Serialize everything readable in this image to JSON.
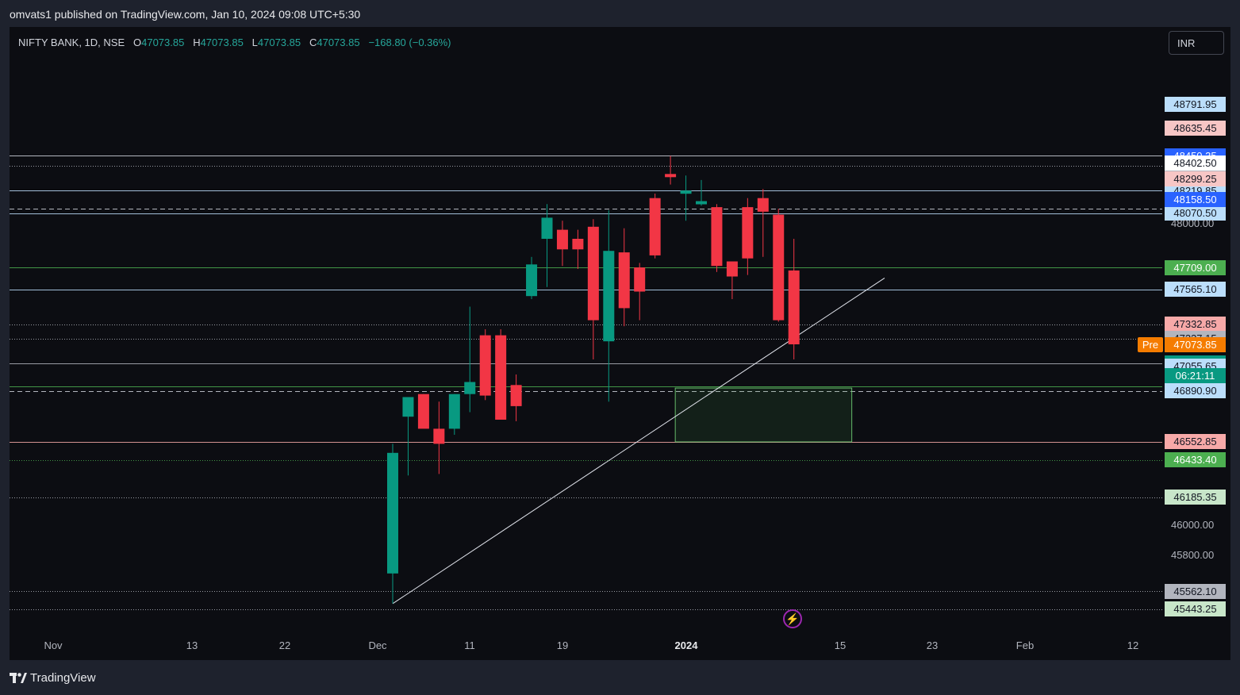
{
  "publisher": "omvats1 published on TradingView.com, Jan 10, 2024 09:08 UTC+5:30",
  "legend": {
    "symbol": "NIFTY BANK, 1D, NSE",
    "o_label": "O",
    "o": "47073.85",
    "h_label": "H",
    "h": "47073.85",
    "l_label": "L",
    "l": "47073.85",
    "c_label": "C",
    "c": "47073.85",
    "change": "−168.80 (−0.36%)"
  },
  "currency": "INR",
  "brand": "TradingView",
  "pre_label": "Pre",
  "countdown": "06:21:11",
  "colors": {
    "up": "#089981",
    "down": "#f23645",
    "background": "#0c0d12"
  },
  "chart_data": {
    "type": "candlestick",
    "x_axis_labels": [
      {
        "label": "Nov",
        "day": 0
      },
      {
        "label": "13",
        "day": 12
      },
      {
        "label": "22",
        "day": 21
      },
      {
        "label": "Dec",
        "day": 30
      },
      {
        "label": "11",
        "day": 40
      },
      {
        "label": "19",
        "day": 48
      },
      {
        "label": "2024",
        "day": 61,
        "bold": true
      },
      {
        "label": "15",
        "day": 75
      },
      {
        "label": "23",
        "day": 83
      },
      {
        "label": "Feb",
        "day": 92
      },
      {
        "label": "12",
        "day": 103
      }
    ],
    "y_axis_ticks": [
      48000,
      46000,
      45800
    ],
    "y_range": [
      45350,
      48800
    ],
    "candles": [
      {
        "date": "2023-12-04",
        "o": 45680,
        "h": 46540,
        "l": 45480,
        "c": 46480
      },
      {
        "date": "2023-12-05",
        "o": 46720,
        "h": 46840,
        "l": 46330,
        "c": 46850
      },
      {
        "date": "2023-12-06",
        "o": 46870,
        "h": 46870,
        "l": 46680,
        "c": 46640
      },
      {
        "date": "2023-12-07",
        "o": 46640,
        "h": 46820,
        "l": 46340,
        "c": 46540
      },
      {
        "date": "2023-12-08",
        "o": 46640,
        "h": 46870,
        "l": 46600,
        "c": 46870
      },
      {
        "date": "2023-12-11",
        "o": 46870,
        "h": 47450,
        "l": 46750,
        "c": 46950
      },
      {
        "date": "2023-12-12",
        "o": 47260,
        "h": 47300,
        "l": 46830,
        "c": 46860
      },
      {
        "date": "2023-12-13",
        "o": 47260,
        "h": 47300,
        "l": 46720,
        "c": 46700
      },
      {
        "date": "2023-12-14",
        "o": 46930,
        "h": 47000,
        "l": 46690,
        "c": 46790
      },
      {
        "date": "2023-12-15",
        "o": 47520,
        "h": 47780,
        "l": 47500,
        "c": 47730
      },
      {
        "date": "2023-12-18",
        "o": 47900,
        "h": 48130,
        "l": 47580,
        "c": 48040
      },
      {
        "date": "2023-12-19",
        "o": 47960,
        "h": 48020,
        "l": 47720,
        "c": 47830
      },
      {
        "date": "2023-12-20",
        "o": 47900,
        "h": 47960,
        "l": 47700,
        "c": 47830
      },
      {
        "date": "2023-12-21",
        "o": 47980,
        "h": 48030,
        "l": 47100,
        "c": 47360
      },
      {
        "date": "2023-12-22",
        "o": 47220,
        "h": 48090,
        "l": 46820,
        "c": 47820
      },
      {
        "date": "2023-12-26",
        "o": 47810,
        "h": 47970,
        "l": 47320,
        "c": 47440
      },
      {
        "date": "2023-12-27",
        "o": 47710,
        "h": 47740,
        "l": 47360,
        "c": 47550
      },
      {
        "date": "2023-12-28",
        "o": 48170,
        "h": 48200,
        "l": 47770,
        "c": 47790
      },
      {
        "date": "2023-12-29",
        "o": 48330,
        "h": 48450,
        "l": 48260,
        "c": 48310
      },
      {
        "date": "2024-01-01",
        "o": 48200,
        "h": 48320,
        "l": 48020,
        "c": 48220
      },
      {
        "date": "2024-01-02",
        "o": 48130,
        "h": 48290,
        "l": 48120,
        "c": 48150
      },
      {
        "date": "2024-01-03",
        "o": 48110,
        "h": 48130,
        "l": 47680,
        "c": 47720
      },
      {
        "date": "2024-01-04",
        "o": 47750,
        "h": 47750,
        "l": 47500,
        "c": 47650
      },
      {
        "date": "2024-01-05",
        "o": 48110,
        "h": 48170,
        "l": 47660,
        "c": 47770
      },
      {
        "date": "2024-01-08",
        "o": 48170,
        "h": 48230,
        "l": 47780,
        "c": 48080
      },
      {
        "date": "2024-01-09",
        "o": 48060,
        "h": 48100,
        "l": 47350,
        "c": 47360
      },
      {
        "date": "2024-01-10",
        "o": 47690,
        "h": 47900,
        "l": 47100,
        "c": 47200
      }
    ],
    "price_lines": [
      {
        "value": 48450.35,
        "label": "48450.35",
        "bg": "#2962ff",
        "fg": "#ffffff",
        "line": "#d1d4dc",
        "style": "solid"
      },
      {
        "value": 48382.75,
        "label": "48382.75",
        "bg": "#b2b5be",
        "fg": "#131722",
        "line": "#b2b5be",
        "style": "dotted"
      },
      {
        "value": 48219.85,
        "label": "48219.85",
        "bg": "#bbdefb",
        "fg": "#131722",
        "line": "#bbdefb",
        "style": "solid"
      },
      {
        "value": 48098.0,
        "label": "48098.00",
        "bg": "#bbdefb",
        "fg": "#131722",
        "line": "#d1d4dc",
        "style": "dashed"
      },
      {
        "value": 48070.5,
        "label": "48070.50",
        "bg": "#bbdefb",
        "fg": "#131722",
        "line": "#bbdefb",
        "style": "solid"
      },
      {
        "value": 47709.0,
        "label": "47709.00",
        "bg": "#4caf50",
        "fg": "#ffffff",
        "line": "#4caf50",
        "style": "solid"
      },
      {
        "value": 47565.1,
        "label": "47565.10",
        "bg": "#bbdefb",
        "fg": "#131722",
        "line": "#bbdefb",
        "style": "solid"
      },
      {
        "value": 47332.85,
        "label": "47332.85",
        "bg": "#f7a9a8",
        "fg": "#131722",
        "line": "#b2b5be",
        "style": "dotted"
      },
      {
        "value": 47237.15,
        "label": "47237.15",
        "bg": "#b2b5be",
        "fg": "#131722",
        "line": "#b2b5be",
        "style": "dotted"
      },
      {
        "value": 47073.85,
        "label": "47073.85",
        "bg": "#089981",
        "fg": "#ffffff",
        "line": "#b2b5be",
        "style": "solid"
      },
      {
        "value": 46919.05,
        "label": "46919.05",
        "bg": "#4caf50",
        "fg": "#ffffff",
        "line": "#4caf50",
        "style": "solid"
      },
      {
        "value": 46890.9,
        "label": "46890.90",
        "bg": "#bbdefb",
        "fg": "#131722",
        "line": "#d1d4dc",
        "style": "dashed"
      },
      {
        "value": 46552.85,
        "label": "46552.85",
        "bg": "#f7a9a8",
        "fg": "#131722",
        "line": "#f7a9a8",
        "style": "solid"
      },
      {
        "value": 46433.4,
        "label": "46433.40",
        "bg": "#4caf50",
        "fg": "#ffffff",
        "line": "#4caf50",
        "style": "dotted"
      },
      {
        "value": 46185.35,
        "label": "46185.35",
        "bg": "#c8e6c9",
        "fg": "#131722",
        "line": "#b2b5be",
        "style": "dotted"
      },
      {
        "value": 45562.1,
        "label": "45562.10",
        "bg": "#b2b5be",
        "fg": "#131722",
        "line": "#b2b5be",
        "style": "dotted"
      },
      {
        "value": 45443.25,
        "label": "45443.25",
        "bg": "#c8e6c9",
        "fg": "#131722",
        "line": "#b2b5be",
        "style": "dotted"
      }
    ],
    "axis_only_labels": [
      {
        "value": 48791.95,
        "label": "48791.95",
        "bg": "#bbdefb",
        "fg": "#131722"
      },
      {
        "value": 48635.45,
        "label": "48635.45",
        "bg": "#f7c6c5",
        "fg": "#131722"
      },
      {
        "value": 48402.5,
        "label": "48402.50",
        "bg": "#ffffff",
        "fg": "#131722"
      },
      {
        "value": 48299.25,
        "label": "48299.25",
        "bg": "#f7c6c5",
        "fg": "#131722"
      },
      {
        "value": 48158.5,
        "label": "48158.50",
        "bg": "#2962ff",
        "fg": "#ffffff"
      },
      {
        "value": 47073.85,
        "label": "47073.85",
        "bg": "#f57c00",
        "fg": "#ffffff"
      },
      {
        "value": 47055.65,
        "label": "47055.65",
        "bg": "#bbdefb",
        "fg": "#131722"
      }
    ],
    "trendline": {
      "from": {
        "date": "2023-12-04",
        "value": 45480
      },
      "to": {
        "date": "2024-01-19",
        "value": 47640
      }
    },
    "zone": {
      "from_date": "2024-01-01",
      "to_date": "2024-01-18",
      "top": 46910,
      "bottom": 46552.85
    }
  }
}
